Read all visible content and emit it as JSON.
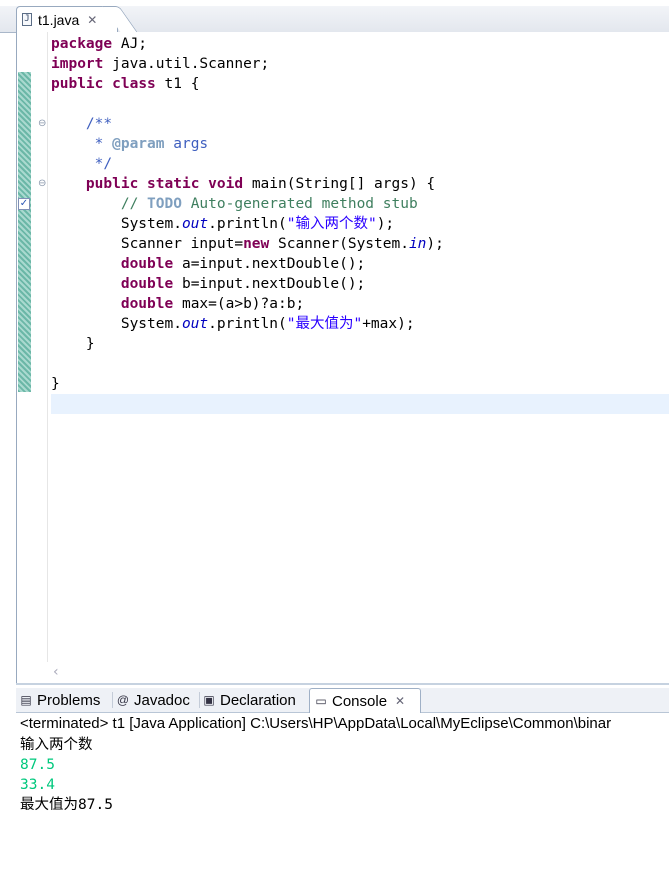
{
  "editor": {
    "tab": {
      "label": "t1.java",
      "icon": "java-file-icon"
    },
    "code_lines": [
      [
        {
          "t": "package",
          "c": "kw"
        },
        {
          "t": " AJ;"
        }
      ],
      [
        {
          "t": "import",
          "c": "kw"
        },
        {
          "t": " java.util.Scanner;"
        }
      ],
      [
        {
          "t": "public",
          "c": "kw"
        },
        {
          "t": " "
        },
        {
          "t": "class",
          "c": "kw"
        },
        {
          "t": " t1 {"
        }
      ],
      [
        {
          "t": ""
        }
      ],
      [
        {
          "t": "    "
        },
        {
          "t": "/**",
          "c": "cm"
        }
      ],
      [
        {
          "t": "     * ",
          "c": "cm"
        },
        {
          "t": "@param",
          "c": "cmtag"
        },
        {
          "t": " args",
          "c": "cm"
        }
      ],
      [
        {
          "t": "     */",
          "c": "cm"
        }
      ],
      [
        {
          "t": "    "
        },
        {
          "t": "public",
          "c": "kw"
        },
        {
          "t": " "
        },
        {
          "t": "static",
          "c": "kw"
        },
        {
          "t": " "
        },
        {
          "t": "void",
          "c": "kw"
        },
        {
          "t": " main(String[] args) {"
        }
      ],
      [
        {
          "t": "        "
        },
        {
          "t": "// ",
          "c": "cmline"
        },
        {
          "t": "TODO",
          "c": "todo"
        },
        {
          "t": " Auto-generated method stub",
          "c": "cmline"
        }
      ],
      [
        {
          "t": "        System."
        },
        {
          "t": "out",
          "c": "field"
        },
        {
          "t": ".println("
        },
        {
          "t": "\"输入两个数\"",
          "c": "str"
        },
        {
          "t": ");"
        }
      ],
      [
        {
          "t": "        Scanner input="
        },
        {
          "t": "new",
          "c": "kw"
        },
        {
          "t": " Scanner(System."
        },
        {
          "t": "in",
          "c": "field"
        },
        {
          "t": ");"
        }
      ],
      [
        {
          "t": "        "
        },
        {
          "t": "double",
          "c": "kw"
        },
        {
          "t": " a=input.nextDouble();"
        }
      ],
      [
        {
          "t": "        "
        },
        {
          "t": "double",
          "c": "kw"
        },
        {
          "t": " b=input.nextDouble();"
        }
      ],
      [
        {
          "t": "        "
        },
        {
          "t": "double",
          "c": "kw"
        },
        {
          "t": " max=(a>b)?a:b;"
        }
      ],
      [
        {
          "t": "        System."
        },
        {
          "t": "out",
          "c": "field"
        },
        {
          "t": ".println("
        },
        {
          "t": "\"最大值为\"",
          "c": "str"
        },
        {
          "t": "+max);"
        }
      ],
      [
        {
          "t": "    }"
        }
      ],
      [
        {
          "t": ""
        }
      ],
      [
        {
          "t": "}"
        }
      ],
      [
        {
          "t": ""
        }
      ]
    ]
  },
  "panel": {
    "tabs": [
      {
        "label": "Problems",
        "icon": "problems-icon"
      },
      {
        "label": "Javadoc",
        "icon": "at-icon"
      },
      {
        "label": "Declaration",
        "icon": "declaration-icon"
      },
      {
        "label": "Console",
        "icon": "console-icon",
        "active": true
      }
    ],
    "console_header": "<terminated> t1 [Java Application] C:\\Users\\HP\\AppData\\Local\\MyEclipse\\Common\\binar",
    "output": [
      {
        "text": "输入两个数",
        "kind": "out"
      },
      {
        "text": "87.5",
        "kind": "in"
      },
      {
        "text": "33.4",
        "kind": "in"
      },
      {
        "text": "最大值为87.5",
        "kind": "out"
      }
    ]
  },
  "colors": {
    "keyword": "#7f0055",
    "string": "#2a00ff",
    "comment": "#3f7f5f",
    "javadoc": "#3f5fbf",
    "field": "#0000c0",
    "console_input": "#00c87d",
    "current_line": "#e8f2fe"
  }
}
